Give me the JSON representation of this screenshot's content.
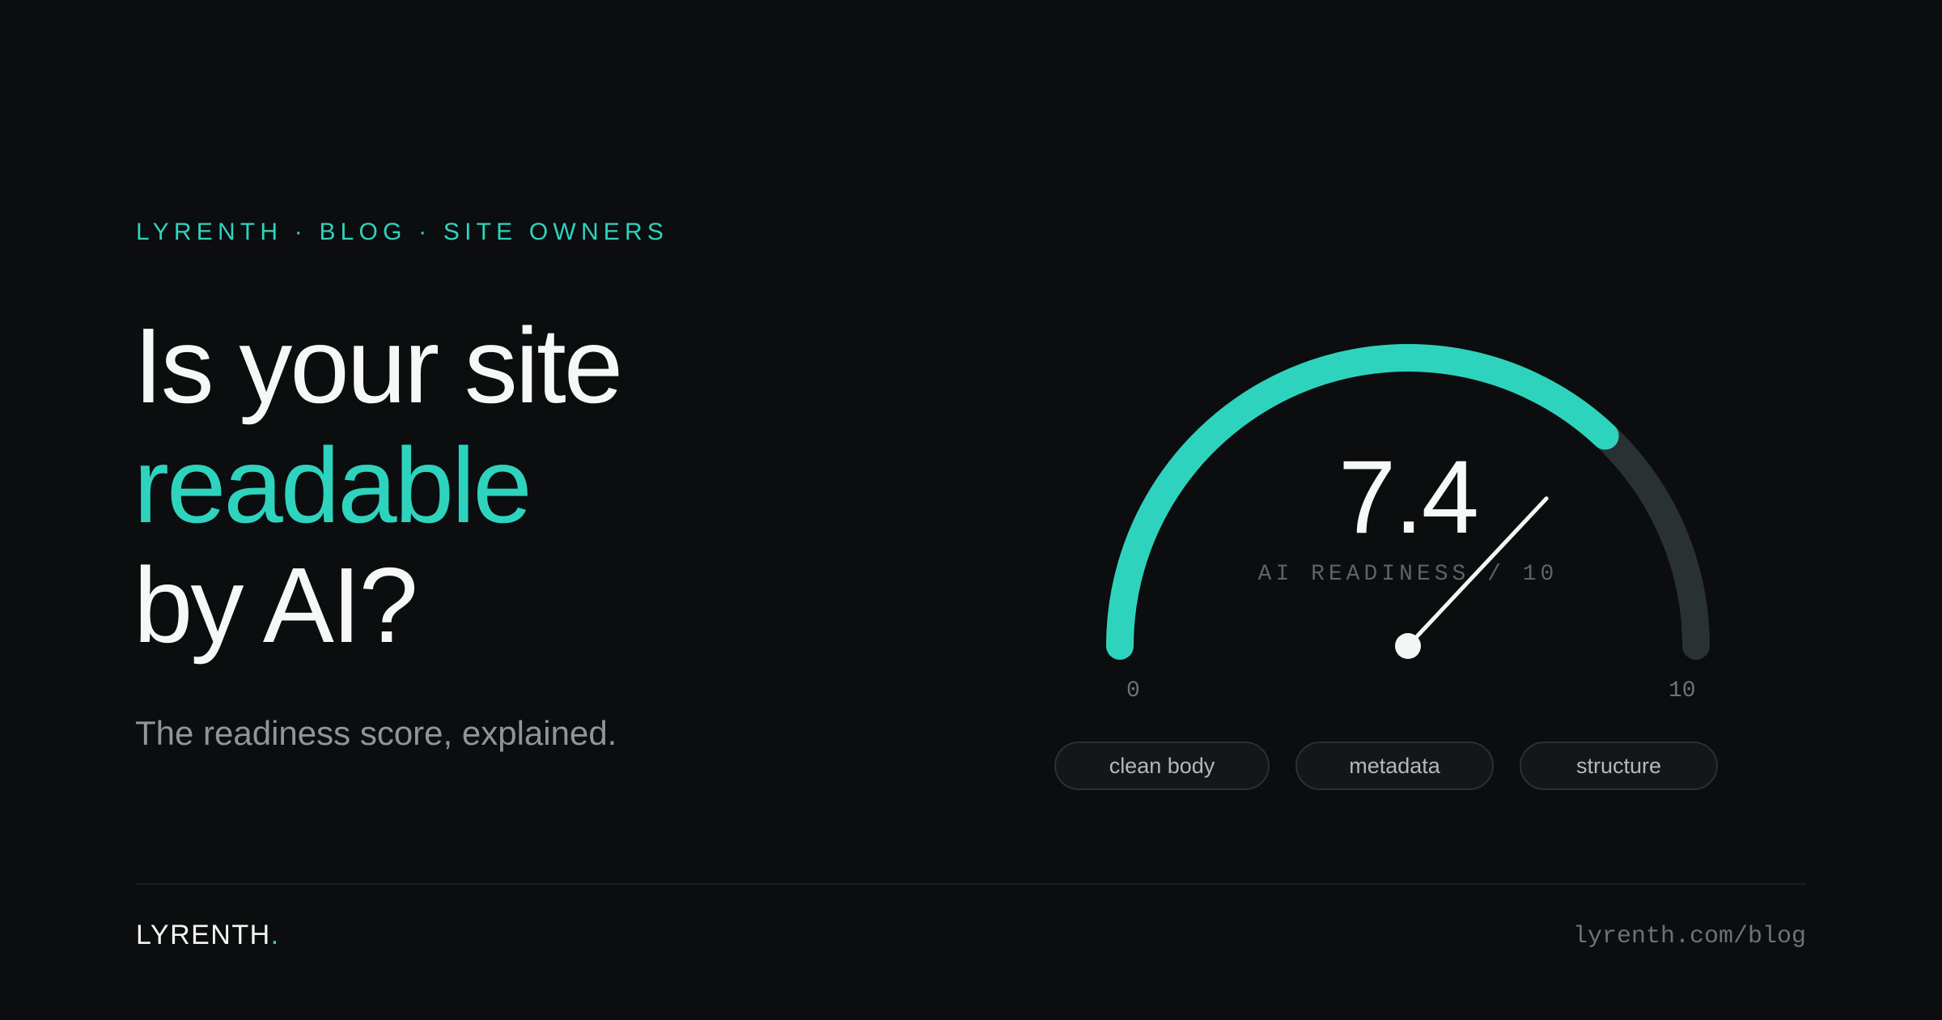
{
  "eyebrow": "LYRENTH · BLOG · SITE OWNERS",
  "headline": {
    "line1": "Is your site",
    "line2": "readable",
    "line3": "by AI?"
  },
  "subtitle": "The readiness score, explained.",
  "gauge": {
    "score": "7.4",
    "value": 7.4,
    "min": 0,
    "max": 10,
    "min_label": "0",
    "max_label": "10",
    "label": "AI READINESS / 10"
  },
  "chips": [
    "clean body",
    "metadata",
    "structure"
  ],
  "footer": {
    "brand": "LYRENTH",
    "brand_dot": ".",
    "url": "lyrenth.com/blog"
  },
  "colors": {
    "accent": "#2ed3be",
    "track": "#2a3132",
    "background": "#0b0d0f",
    "text": "#f4f5f5"
  }
}
